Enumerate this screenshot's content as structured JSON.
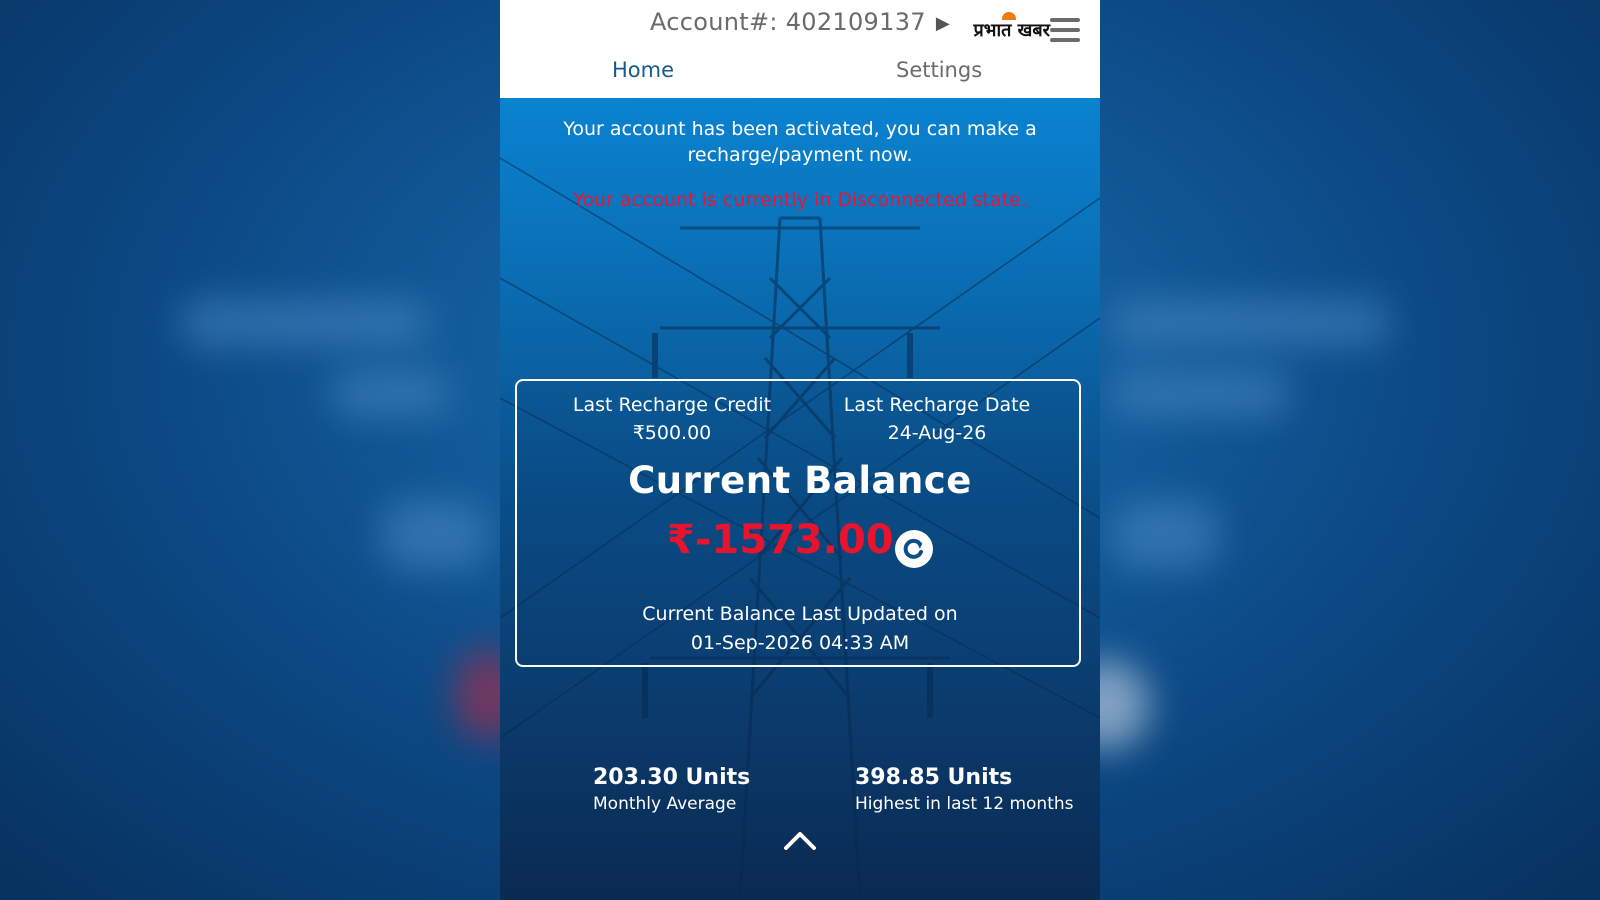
{
  "header": {
    "account_label": "Account#: 402109137",
    "logo_text": "प्रभात खबर"
  },
  "tabs": [
    {
      "label": "Home",
      "active": true
    },
    {
      "label": "Settings",
      "active": false
    }
  ],
  "messages": {
    "activated": "Your account has been activated, you can make a recharge/payment now.",
    "state": "Your account is currently in Disconnected state."
  },
  "card": {
    "last_recharge_credit_label": "Last Recharge Credit",
    "last_recharge_credit_value": "₹500.00",
    "last_recharge_date_label": "Last Recharge Date",
    "last_recharge_date_value": "24-Aug-26",
    "balance_title": "Current Balance",
    "balance_amount": "₹-1573.00",
    "updated_label": "Current Balance Last Updated on",
    "updated_value": "01-Sep-2026 04:33 AM"
  },
  "stats": [
    {
      "value": "203.30 Units",
      "label": "Monthly Average"
    },
    {
      "value": "398.85 Units",
      "label": "Highest in last 12 months"
    }
  ],
  "colors": {
    "alert_red": "#e3173a",
    "balance_red": "#e8142e",
    "tab_active": "#145a8c"
  },
  "icons": [
    "caret-right-icon",
    "menu-icon",
    "refresh-icon",
    "chevron-up-icon",
    "logo-sun-icon"
  ]
}
